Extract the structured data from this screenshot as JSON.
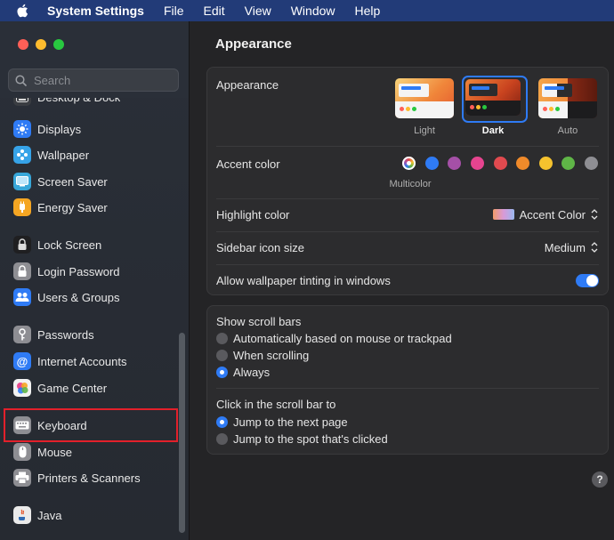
{
  "menubar": {
    "app_name": "System Settings",
    "items": [
      "File",
      "Edit",
      "View",
      "Window",
      "Help"
    ]
  },
  "sidebar": {
    "search_placeholder": "Search",
    "items": [
      {
        "label": "Desktop & Dock",
        "icon": "desktop-dock-icon"
      },
      {
        "label": "Displays",
        "icon": "displays-icon"
      },
      {
        "label": "Wallpaper",
        "icon": "wallpaper-icon"
      },
      {
        "label": "Screen Saver",
        "icon": "screen-saver-icon"
      },
      {
        "label": "Energy Saver",
        "icon": "energy-saver-icon"
      },
      {
        "label": "Lock Screen",
        "icon": "lock-screen-icon"
      },
      {
        "label": "Login Password",
        "icon": "login-password-icon"
      },
      {
        "label": "Users & Groups",
        "icon": "users-groups-icon"
      },
      {
        "label": "Passwords",
        "icon": "passwords-icon"
      },
      {
        "label": "Internet Accounts",
        "icon": "internet-accounts-icon"
      },
      {
        "label": "Game Center",
        "icon": "game-center-icon"
      },
      {
        "label": "Keyboard",
        "icon": "keyboard-icon"
      },
      {
        "label": "Mouse",
        "icon": "mouse-icon"
      },
      {
        "label": "Printers & Scanners",
        "icon": "printers-scanners-icon"
      },
      {
        "label": "Java",
        "icon": "java-icon"
      }
    ],
    "highlighted_item": "Keyboard"
  },
  "main": {
    "title": "Appearance",
    "appearance": {
      "label": "Appearance",
      "options": [
        "Light",
        "Dark",
        "Auto"
      ],
      "selected": "Dark"
    },
    "accent_color": {
      "label": "Accent color",
      "selected_caption": "Multicolor",
      "colors": [
        "multicolor",
        "#2f7bf5",
        "#a550a7",
        "#e6448f",
        "#e14a4f",
        "#f08a2a",
        "#f5c22e",
        "#5fb547",
        "#8e8e93"
      ]
    },
    "highlight_color": {
      "label": "Highlight color",
      "value": "Accent Color"
    },
    "sidebar_icon_size": {
      "label": "Sidebar icon size",
      "value": "Medium"
    },
    "wallpaper_tinting": {
      "label": "Allow wallpaper tinting in windows",
      "enabled": true
    },
    "scroll_bars": {
      "label": "Show scroll bars",
      "options": [
        "Automatically based on mouse or trackpad",
        "When scrolling",
        "Always"
      ],
      "selected": "Always"
    },
    "click_scroll_bar": {
      "label": "Click in the scroll bar to",
      "options": [
        "Jump to the next page",
        "Jump to the spot that's clicked"
      ],
      "selected": "Jump to the next page"
    },
    "help_label": "?"
  }
}
